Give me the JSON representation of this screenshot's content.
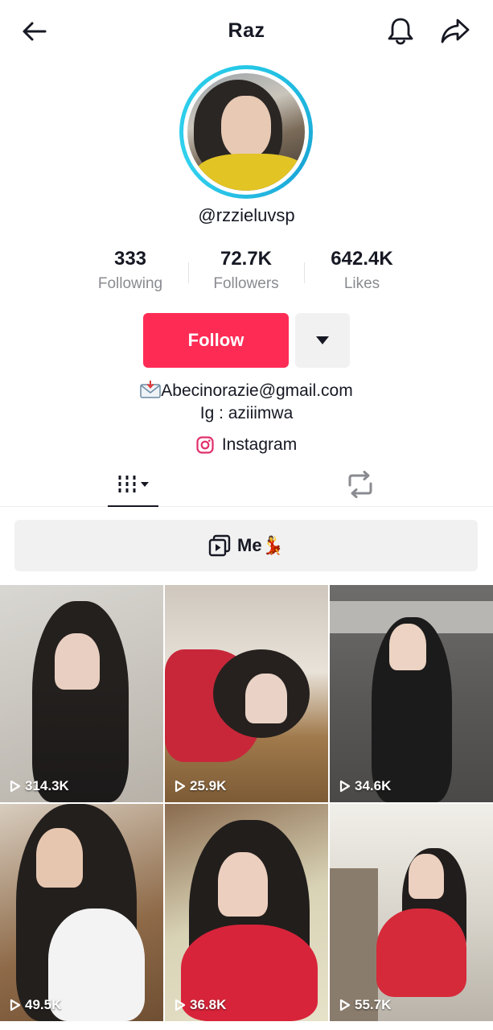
{
  "header": {
    "title": "Raz",
    "back_icon": "arrow-left-icon",
    "bell_icon": "bell-icon",
    "share_icon": "share-icon"
  },
  "profile": {
    "username": "@rzzieluvsp",
    "ring_color": "#25c8e6"
  },
  "stats": [
    {
      "value": "333",
      "label": "Following"
    },
    {
      "value": "72.7K",
      "label": "Followers"
    },
    {
      "value": "642.4K",
      "label": "Likes"
    }
  ],
  "actions": {
    "follow_label": "Follow",
    "follow_color": "#fe2c55",
    "more_icon": "caret-down-icon"
  },
  "bio": {
    "email_line": "Abecinorazie@gmail.com",
    "ig_line": "Ig : aziiimwa"
  },
  "link": {
    "label": "Instagram",
    "icon": "instagram-icon"
  },
  "tabs": {
    "videos_icon": "grid-videos-icon",
    "reposts_icon": "repost-icon"
  },
  "playlist": {
    "label": "Me💃",
    "icon": "playlist-icon"
  },
  "videos": [
    {
      "views": "314.3K"
    },
    {
      "views": "25.9K"
    },
    {
      "views": "34.6K"
    },
    {
      "views": "49.5K"
    },
    {
      "views": "36.8K"
    },
    {
      "views": "55.7K"
    }
  ]
}
